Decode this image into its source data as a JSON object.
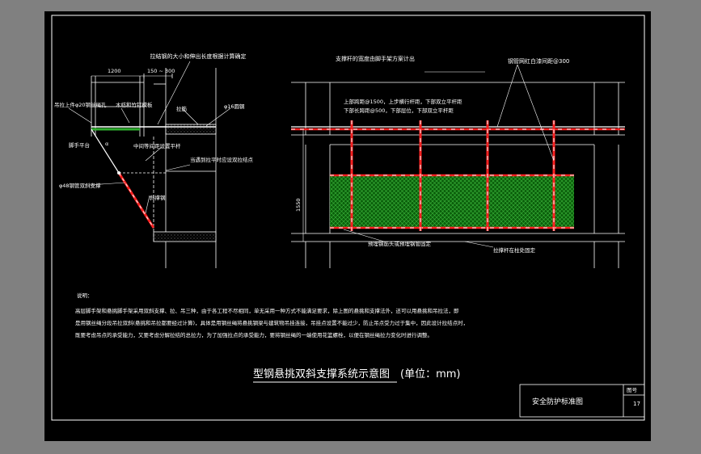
{
  "callouts": {
    "top_tie": "拉结钢的大小和伸出长度根据计算确定",
    "shoring_rod": "支撑杆的宽度由脚手架方案计出",
    "pipe_spacing": "钢管网红白漆间距@300",
    "tie_ring": "吊拉上件φ20钢丝绳孔",
    "wood_plank": "木枋和竹钉模板",
    "anchor_steel": "拉筋",
    "round_bar": "φ16圆钢",
    "walkboard": "脚手平台",
    "mid_rail": "中间等间距设置平杆",
    "angle": "α",
    "tie_note": "当遇到拉平时应设双拉结点",
    "diagonal_tube": "φ48钢管双斜支撑",
    "inclined_bar": "斜撑钢",
    "height_label": "1550",
    "anchor_embed": "预埋钢筋头或预埋钢管固定",
    "column_fix": "拉撑杆在柱处固定",
    "dim_1200": "1200",
    "dim_150_300": "150 ~ 300",
    "spec_line1": "上部跨距@1500，上步横行杆距，下部双立平杆距",
    "spec_line2": "下部长跨距@500，下部层位，下部双立平杆距"
  },
  "notes": {
    "heading": "说明：",
    "line1": "高层脚手架和悬挑脚手架采用双斜支撑、拉、吊三种，由于各工程不尽相同，单无采用一种方式不能满足要求，除上图的悬挑和支撑法外，还可以用悬挑和吊拉法，即",
    "line2": "是用钢丝绳分段吊拉双斜(悬挑和吊拉都要经过计算)，具体是用钢丝绳将悬挑钢梁与建筑物吊挂连接，吊挂点设置不能过少，防止吊点受力过于集中，因此设计拉结点时，",
    "line3": "既要考虑吊点的承受能力，又要考虑分解拉结的总拉力，为了加强拉点的承受能力，要将钢丝绳的一端使用花篮螺栓，以便在钢丝绳拉力变化时进行调整。"
  },
  "title": {
    "main": "型钢悬挑双斜支撑系统示意图",
    "unit": "(单位：mm)"
  },
  "title_block": {
    "name": "安全防护标准图",
    "fig_label": "图号",
    "fig_number": "17"
  },
  "colors": {
    "background": "#000000",
    "frame": "#ffffff",
    "highlight_red": "#ff2020",
    "net_green": "#2e8b2e",
    "workspace": "#808080"
  }
}
